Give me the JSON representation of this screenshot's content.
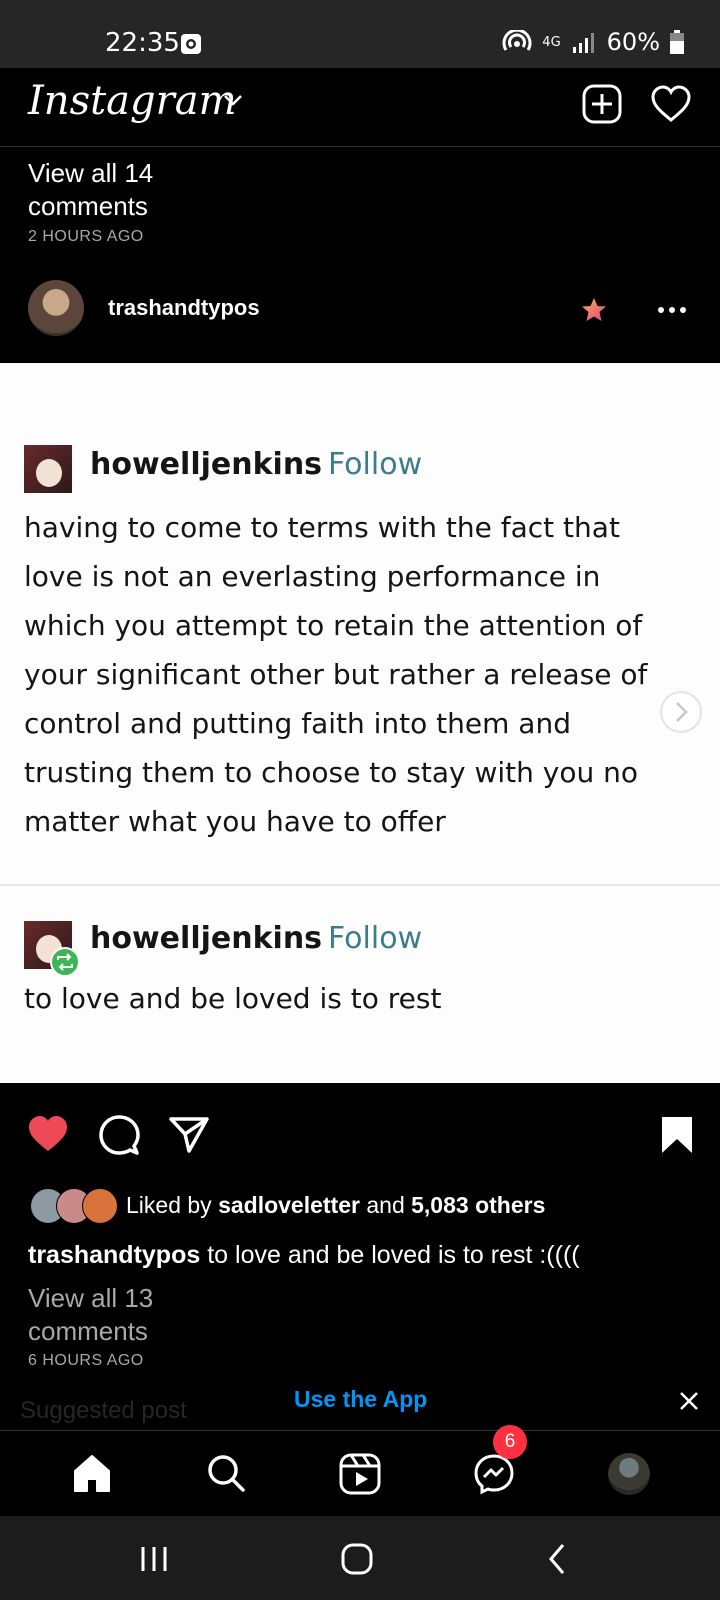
{
  "status_bar": {
    "time": "22:35",
    "network": "4G",
    "battery": "60%"
  },
  "header": {
    "logo": "Instagram"
  },
  "prev_post": {
    "view_comments": "View all 14 comments",
    "time_ago": "2 HOURS AGO"
  },
  "post": {
    "username": "trashandtypos",
    "tumblr": {
      "user1": "howelljenkins",
      "follow1": "Follow",
      "text1": "having to come to terms with the fact that love is not an everlasting performance in which you attempt to retain the attention of your significant other but rather a release of control and putting faith into them and trusting them to choose to stay with you no matter what you have to offer",
      "user2": "howelljenkins",
      "follow2": "Follow",
      "text2": "to love and be loved is to rest"
    },
    "liked_by_prefix": "Liked by",
    "liked_by_user": "sadloveletter",
    "liked_by_and": "and",
    "liked_by_others": "5,083 others",
    "caption_user": "trashandtypos",
    "caption_text": "to love and be loved is to rest :((((",
    "view_comments": "View all 13 comments",
    "time_ago": "6 HOURS AGO"
  },
  "banner": {
    "suggested": "Suggested post",
    "use_app": "Use the App"
  },
  "nav": {
    "messenger_badge": "6"
  },
  "colors": {
    "like_red": "#ed4956",
    "link_blue": "#0095f6",
    "follow_teal": "#3b7c8f"
  }
}
